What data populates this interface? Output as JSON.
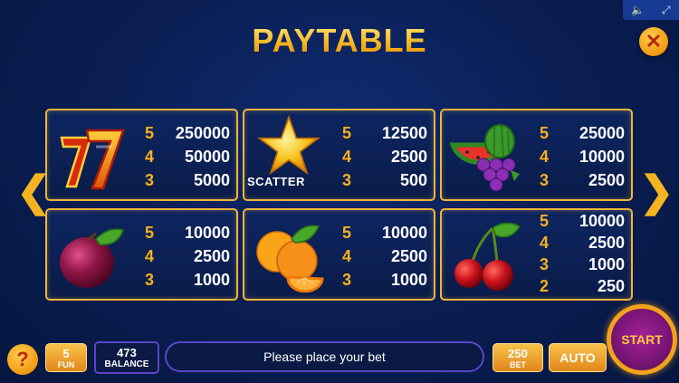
{
  "header": {
    "title": "PAYTABLE",
    "sound_icon": "speaker-icon",
    "fullscreen_icon": "fullscreen-icon",
    "close_symbol": "✕"
  },
  "navigation": {
    "prev_symbol": "❮",
    "next_symbol": "❯"
  },
  "symbols": [
    {
      "name": "seven",
      "label": "",
      "pays": [
        {
          "count": "5",
          "value": "250000"
        },
        {
          "count": "4",
          "value": "50000"
        },
        {
          "count": "3",
          "value": "5000"
        }
      ]
    },
    {
      "name": "star",
      "label": "SCATTER",
      "pays": [
        {
          "count": "5",
          "value": "12500"
        },
        {
          "count": "4",
          "value": "2500"
        },
        {
          "count": "3",
          "value": "500"
        }
      ]
    },
    {
      "name": "watermelon-grapes",
      "label": "",
      "pays": [
        {
          "count": "5",
          "value": "25000"
        },
        {
          "count": "4",
          "value": "10000"
        },
        {
          "count": "3",
          "value": "2500"
        }
      ]
    },
    {
      "name": "plum",
      "label": "",
      "pays": [
        {
          "count": "5",
          "value": "10000"
        },
        {
          "count": "4",
          "value": "2500"
        },
        {
          "count": "3",
          "value": "1000"
        }
      ]
    },
    {
      "name": "orange",
      "label": "",
      "pays": [
        {
          "count": "5",
          "value": "10000"
        },
        {
          "count": "4",
          "value": "2500"
        },
        {
          "count": "3",
          "value": "1000"
        }
      ]
    },
    {
      "name": "cherry",
      "label": "",
      "pays": [
        {
          "count": "5",
          "value": "10000"
        },
        {
          "count": "4",
          "value": "2500"
        },
        {
          "count": "3",
          "value": "1000"
        },
        {
          "count": "2",
          "value": "250"
        }
      ]
    }
  ],
  "bottom_bar": {
    "help_symbol": "?",
    "fun": {
      "value": "5",
      "label": "FUN"
    },
    "balance": {
      "value": "473",
      "label": "BALANCE"
    },
    "message": "Please place your bet",
    "bet": {
      "value": "250",
      "label": "BET"
    },
    "auto_label": "AUTO",
    "start_label": "START"
  },
  "colors": {
    "accent_gold": "#f7b21a",
    "background": "#0a1f55",
    "start_purple": "#7b1677"
  }
}
